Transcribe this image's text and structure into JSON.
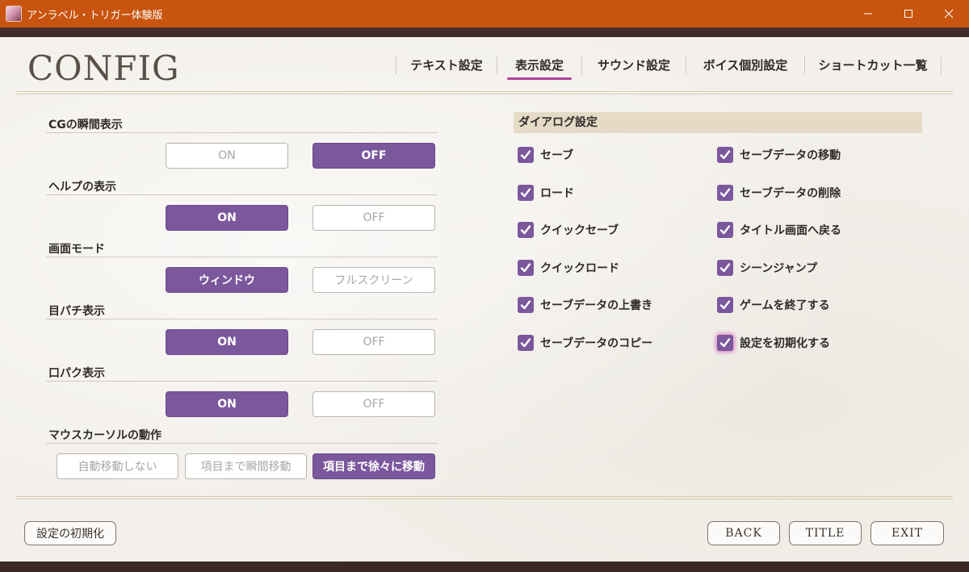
{
  "window": {
    "title": "アンラベル・トリガー体験版",
    "minimize_glyph": "–",
    "maximize_glyph": "☐",
    "close_glyph": "✕"
  },
  "header": {
    "title": "CONFIG",
    "tabs": [
      {
        "label": "テキスト設定",
        "active": false
      },
      {
        "label": "表示設定",
        "active": true
      },
      {
        "label": "サウンド設定",
        "active": false
      },
      {
        "label": "ボイス個別設定",
        "active": false
      },
      {
        "label": "ショートカット一覧",
        "active": false
      }
    ]
  },
  "settings": [
    {
      "label": "CGの瞬間表示",
      "options": [
        {
          "text": "ON",
          "selected": false
        },
        {
          "text": "OFF",
          "selected": true
        }
      ]
    },
    {
      "label": "ヘルプの表示",
      "options": [
        {
          "text": "ON",
          "selected": true
        },
        {
          "text": "OFF",
          "selected": false
        }
      ]
    },
    {
      "label": "画面モード",
      "options": [
        {
          "text": "ウィンドウ",
          "selected": true
        },
        {
          "text": "フルスクリーン",
          "selected": false
        }
      ]
    },
    {
      "label": "目パチ表示",
      "options": [
        {
          "text": "ON",
          "selected": true
        },
        {
          "text": "OFF",
          "selected": false
        }
      ]
    },
    {
      "label": "口パク表示",
      "options": [
        {
          "text": "ON",
          "selected": true
        },
        {
          "text": "OFF",
          "selected": false
        }
      ]
    },
    {
      "label": "マウスカーソルの動作",
      "options": [
        {
          "text": "自動移動しない",
          "selected": false
        },
        {
          "text": "項目まで瞬間移動",
          "selected": false
        },
        {
          "text": "項目まで徐々に移動",
          "selected": true
        }
      ]
    }
  ],
  "dialog": {
    "title": "ダイアログ設定",
    "items": [
      {
        "label": "セーブ",
        "checked": true
      },
      {
        "label": "セーブデータの移動",
        "checked": true
      },
      {
        "label": "ロード",
        "checked": true
      },
      {
        "label": "セーブデータの削除",
        "checked": true
      },
      {
        "label": "クイックセーブ",
        "checked": true
      },
      {
        "label": "タイトル画面へ戻る",
        "checked": true
      },
      {
        "label": "クイックロード",
        "checked": true
      },
      {
        "label": "シーンジャンプ",
        "checked": true
      },
      {
        "label": "セーブデータの上書き",
        "checked": true
      },
      {
        "label": "ゲームを終了する",
        "checked": true
      },
      {
        "label": "セーブデータのコピー",
        "checked": true
      },
      {
        "label": "設定を初期化する",
        "checked": true,
        "highlighted": true
      }
    ]
  },
  "footer": {
    "reset_label": "設定の初期化",
    "back_label": "BACK",
    "title_label": "TITLE",
    "exit_label": "EXIT"
  },
  "colors": {
    "titlebar": "#c8540f",
    "accent_purple": "#7b579c",
    "tab_underline": "#b0439a",
    "dialog_header_bg": "#e5dac6"
  }
}
